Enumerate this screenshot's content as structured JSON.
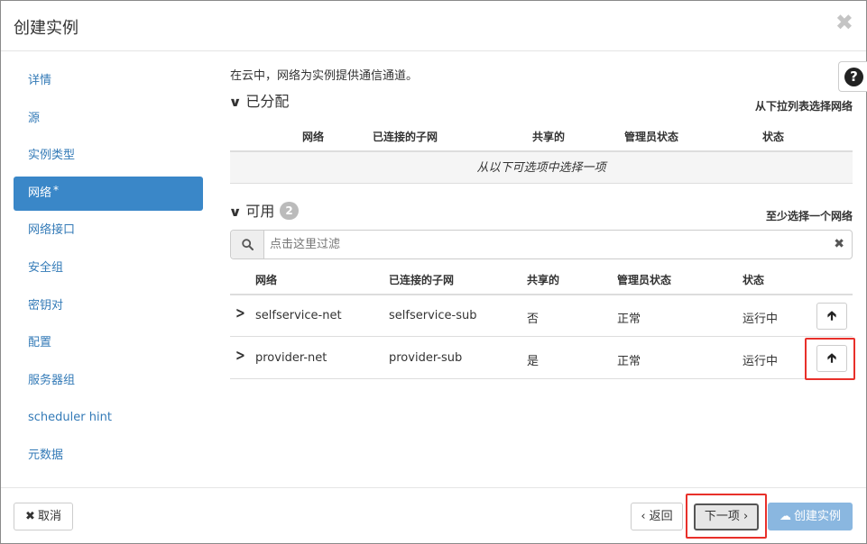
{
  "modal": {
    "title": "创建实例",
    "close_symbol": "✖"
  },
  "sidebar": {
    "items": [
      {
        "label": "详情"
      },
      {
        "label": "源"
      },
      {
        "label": "实例类型"
      },
      {
        "label": "网络",
        "required_mark": "*",
        "active": true
      },
      {
        "label": "网络接口"
      },
      {
        "label": "安全组"
      },
      {
        "label": "密钥对"
      },
      {
        "label": "配置"
      },
      {
        "label": "服务器组"
      },
      {
        "label": "scheduler hint"
      },
      {
        "label": "元数据"
      }
    ]
  },
  "help": {
    "symbol": "?",
    "icon": "question-circle-icon"
  },
  "content": {
    "intro": "在云中，网络为实例提供通信通道。",
    "allocated": {
      "title": "已分配",
      "hint": "从下拉列表选择网络",
      "columns": [
        "网络",
        "已连接的子网",
        "共享的",
        "管理员状态",
        "状态"
      ],
      "empty_text": "从以下可选项中选择一项"
    },
    "available": {
      "title": "可用",
      "count": "2",
      "hint": "至少选择一个网络",
      "filter_placeholder": "点击这里过滤",
      "columns": [
        "网络",
        "已连接的子网",
        "共享的",
        "管理员状态",
        "状态"
      ],
      "rows": [
        {
          "network": "selfservice-net",
          "subnet": "selfservice-sub",
          "shared": "否",
          "admin_state": "正常",
          "status": "运行中"
        },
        {
          "network": "provider-net",
          "subnet": "provider-sub",
          "shared": "是",
          "admin_state": "正常",
          "status": "运行中"
        }
      ]
    }
  },
  "footer": {
    "cancel_label": "取消",
    "back_label": "‹ 返回",
    "next_label": "下一项 ›",
    "create_label": "创建实例"
  },
  "colors": {
    "active_nav": "#3a87c8",
    "link": "#337ab7",
    "highlight": "#e8302a",
    "create_button": "#8ab7e0"
  }
}
